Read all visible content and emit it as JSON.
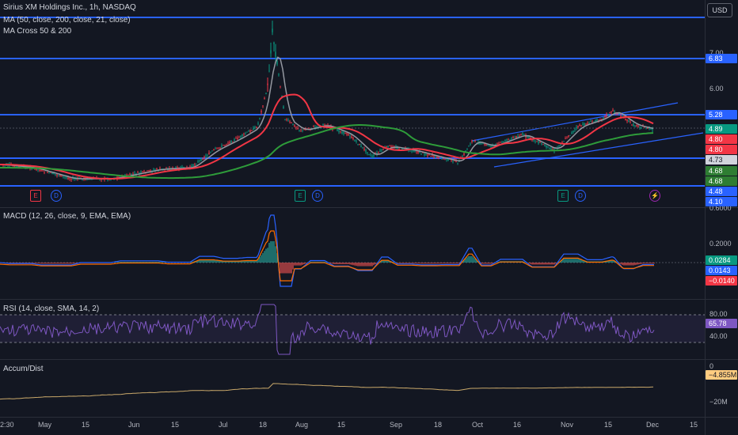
{
  "legend": {
    "title": "Sirius XM Holdings Inc., 1h, NASDAQ",
    "ma": "MA (50, close, 200, close, 21, close)",
    "cross": "MA Cross 50 & 200",
    "macd": "MACD (12, 26, close, 9, EMA, EMA)",
    "rsi": "RSI (14, close, SMA, 14, 2)",
    "accum": "Accum/Dist"
  },
  "currency": "USD",
  "price_ticks": [
    "7.00",
    "6.00"
  ],
  "price_tags": [
    {
      "text": "6.83",
      "bg": "#2962ff",
      "fg": "#ffffff"
    },
    {
      "text": "5.28",
      "bg": "#2962ff",
      "fg": "#ffffff"
    },
    {
      "text": "4.89",
      "bg": "#089981",
      "fg": "#ffffff"
    },
    {
      "text": "4.80",
      "bg": "#f23645",
      "fg": "#ffffff"
    },
    {
      "text": "4.80",
      "bg": "#f23645",
      "fg": "#ffffff"
    },
    {
      "text": "4.73",
      "bg": "#d1d4dc",
      "fg": "#131722"
    },
    {
      "text": "4.68",
      "bg": "#2e7d32",
      "fg": "#ffffff"
    },
    {
      "text": "4.68",
      "bg": "#2e7d32",
      "fg": "#ffffff"
    },
    {
      "text": "4.48",
      "bg": "#2962ff",
      "fg": "#ffffff"
    },
    {
      "text": "4.10",
      "bg": "#2962ff",
      "fg": "#ffffff"
    }
  ],
  "macd_ticks": [
    "0.6000",
    "0.2000"
  ],
  "macd_tags": [
    {
      "text": "0.0284",
      "bg": "#089981",
      "fg": "#ffffff"
    },
    {
      "text": "0.0143",
      "bg": "#2962ff",
      "fg": "#ffffff"
    },
    {
      "text": "−0.0140",
      "bg": "#f23645",
      "fg": "#ffffff"
    }
  ],
  "rsi_ticks": [
    "80.00",
    "40.00"
  ],
  "rsi_tag": {
    "text": "65.78",
    "bg": "#7e57c2",
    "fg": "#ffffff"
  },
  "ad_ticks": [
    "0",
    "−20M"
  ],
  "ad_tag": {
    "text": "−4.855M",
    "bg": "#ffcc80",
    "fg": "#131722"
  },
  "x_labels": [
    "2:30",
    "May",
    "15",
    "Jun",
    "15",
    "Jul",
    "18",
    "Aug",
    "15",
    "Sep",
    "18",
    "Oct",
    "16",
    "Nov",
    "15",
    "Dec",
    "15"
  ],
  "events": [
    {
      "label": "E",
      "color": "#f23645"
    },
    {
      "label": "D",
      "color": "#2962ff"
    },
    {
      "label": "E",
      "color": "#089981"
    },
    {
      "label": "D",
      "color": "#2962ff"
    },
    {
      "label": "E",
      "color": "#089981"
    },
    {
      "label": "D",
      "color": "#2962ff"
    },
    {
      "label": "⚡",
      "color": "#9c27b0"
    }
  ],
  "colors": {
    "ma50": "#f23645",
    "ma200": "#2e9c3a",
    "ma21": "#9598a1",
    "candle_up": "#089981",
    "candle_down": "#f23645",
    "level": "#2962ff",
    "rsi": "#7e57c2",
    "ad": "#ffcc80"
  }
}
